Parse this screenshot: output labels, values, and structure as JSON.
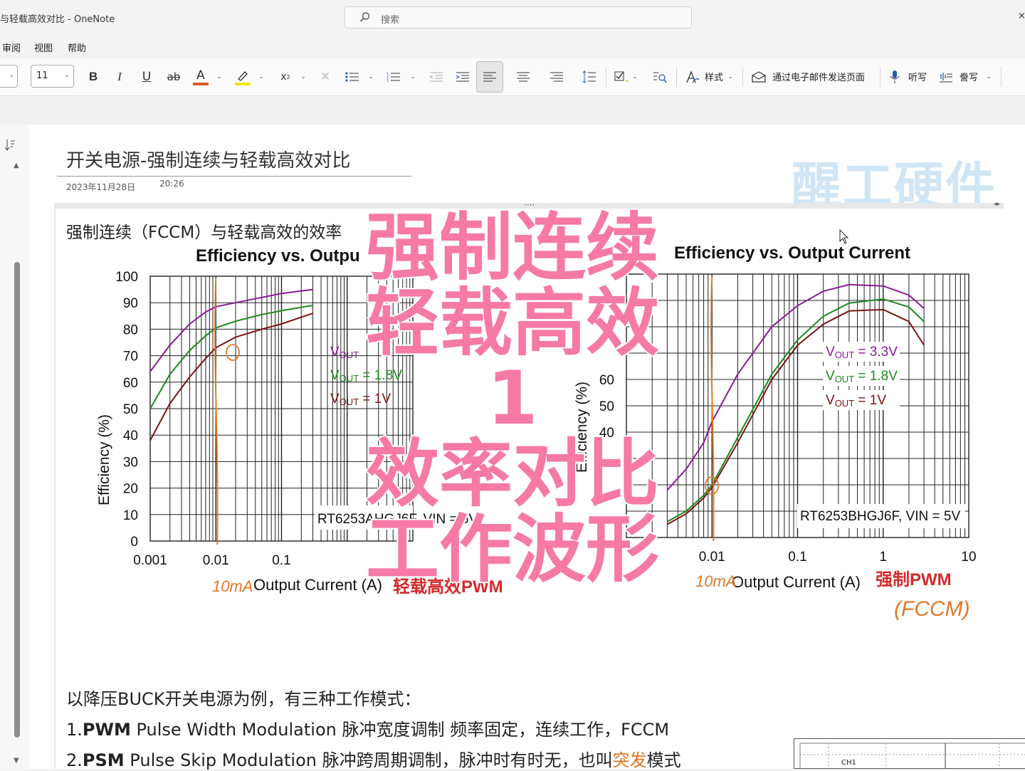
{
  "window": {
    "title": "与轻载高效对比  -  OneNote",
    "close_glyph": "×"
  },
  "search": {
    "placeholder": "搜索"
  },
  "menu": {
    "items": [
      "审阅",
      "视图",
      "帮助"
    ]
  },
  "ribbon": {
    "font_size": "11",
    "bold": "B",
    "italic": "I",
    "underline": "U",
    "strike": "ab",
    "font_color": "A",
    "subscript": "x",
    "styles_label": "样式",
    "email_label": "通过电子邮件发送页面",
    "dictate_label": "听写",
    "transcribe_label": "誊写"
  },
  "page": {
    "title": "开关电源-强制连续与轻载高效对比",
    "date": "2023年11月28日",
    "time": "20:26",
    "watermark": "醒工硬件",
    "container_handle": "····",
    "heading": "强制连续（FCCM）与轻载高效的效率"
  },
  "overlay": {
    "lines": [
      "强制连续",
      "轻载高效",
      "1",
      "效率对比",
      "工作波形"
    ]
  },
  "body_lines": [
    {
      "num": "",
      "bold": "",
      "text": "以降压BUCK开关电源为例，有三种工作模式：",
      "hl": "",
      "tail": ""
    },
    {
      "num": "1.",
      "bold": "PWM",
      "text": "  Pulse Width Modulation 脉冲宽度调制  频率固定，连续工作，FCCM",
      "hl": "",
      "tail": ""
    },
    {
      "num": "2.",
      "bold": "PSM",
      "text": "  Pulse Skip Modulation   脉冲跨周期调制，脉冲时有时无，也叫",
      "hl": "突发",
      "tail": "模式"
    }
  ],
  "mini_scope": {
    "label": "CH1"
  },
  "colors": {
    "purple": "#8a1a96",
    "green": "#1f8a1f",
    "darkred": "#7a1414",
    "orange": "#e07a2a",
    "red": "#d42a2a",
    "pink": "#f679a6"
  },
  "chart_data": [
    {
      "type": "line",
      "title": "Efficiency vs. Outpu",
      "xlabel": "Output Current (A)",
      "ylabel": "Efficiency (%)",
      "x_scale": "log",
      "xlim": [
        0.001,
        10
      ],
      "ylim": [
        0,
        100
      ],
      "x_ticks": [
        "0.001",
        "0.01",
        "0.1"
      ],
      "y_ticks": [
        "0",
        "10",
        "20",
        "30",
        "40",
        "50",
        "60",
        "70",
        "80",
        "90",
        "100"
      ],
      "series": [
        {
          "name": "VOUT = 3.3V",
          "label": "VOUT",
          "color": "#8a1a96",
          "x": [
            0.001,
            0.002,
            0.004,
            0.007,
            0.01,
            0.02,
            0.05,
            0.1,
            0.3
          ],
          "y": [
            64,
            74,
            82,
            86.5,
            88.5,
            90,
            92,
            93.5,
            95
          ]
        },
        {
          "name": "VOUT = 1.8V",
          "label": "VOUT = 1.8V",
          "color": "#1f8a1f",
          "x": [
            0.001,
            0.002,
            0.004,
            0.007,
            0.01,
            0.02,
            0.05,
            0.1,
            0.3
          ],
          "y": [
            50,
            63,
            72,
            77.5,
            80.5,
            83,
            85.5,
            87,
            89
          ]
        },
        {
          "name": "VOUT = 1V",
          "label": "VOUT = 1V",
          "color": "#7a1414",
          "x": [
            0.001,
            0.002,
            0.004,
            0.007,
            0.01,
            0.02,
            0.05,
            0.1,
            0.3
          ],
          "y": [
            38,
            52,
            62,
            69,
            73,
            77,
            80,
            82,
            86
          ]
        }
      ],
      "annotations": {
        "device": "RT6253AHGJ6F, VIN = 5V",
        "mode": "轻载高效PWM",
        "hand_note": "10mA"
      }
    },
    {
      "type": "line",
      "title": "Efficiency vs. Output Current",
      "xlabel": "Output Current (A)",
      "ylabel": "Efficiency (%)",
      "x_scale": "log",
      "xlim": [
        0.001,
        10
      ],
      "ylim": [
        0,
        100
      ],
      "x_ticks": [
        "0.01",
        "0.1",
        "1",
        "10"
      ],
      "y_ticks": [
        "40",
        "50",
        "60"
      ],
      "series": [
        {
          "name": "VOUT = 3.3V",
          "label": "VOUT = 3.3V",
          "color": "#8a1a96",
          "x": [
            0.003,
            0.005,
            0.008,
            0.01,
            0.02,
            0.05,
            0.1,
            0.2,
            0.4,
            1,
            2,
            3
          ],
          "y": [
            18,
            26,
            36,
            44,
            62,
            80,
            88,
            93.5,
            96,
            95.5,
            92,
            87
          ]
        },
        {
          "name": "VOUT = 1.8V",
          "label": "VOUT = 1.8V",
          "color": "#1f8a1f",
          "x": [
            0.003,
            0.005,
            0.008,
            0.01,
            0.02,
            0.05,
            0.1,
            0.2,
            0.4,
            1,
            2,
            3
          ],
          "y": [
            6,
            10,
            16,
            20,
            38,
            62,
            75,
            84,
            89,
            90.5,
            87.5,
            82
          ]
        },
        {
          "name": "VOUT = 1V",
          "label": "VOUT = 1V",
          "color": "#7a1414",
          "x": [
            0.003,
            0.005,
            0.008,
            0.01,
            0.02,
            0.05,
            0.1,
            0.2,
            0.4,
            1,
            2,
            3
          ],
          "y": [
            5,
            9,
            15,
            19,
            36,
            60,
            73,
            81,
            86,
            86.5,
            82,
            73
          ]
        }
      ],
      "annotations": {
        "device": "RT6253BHGJ6F, VIN = 5V",
        "mode": "强制PWM",
        "mode_note": "(FCCM)",
        "hand_note": "10mA"
      }
    }
  ]
}
